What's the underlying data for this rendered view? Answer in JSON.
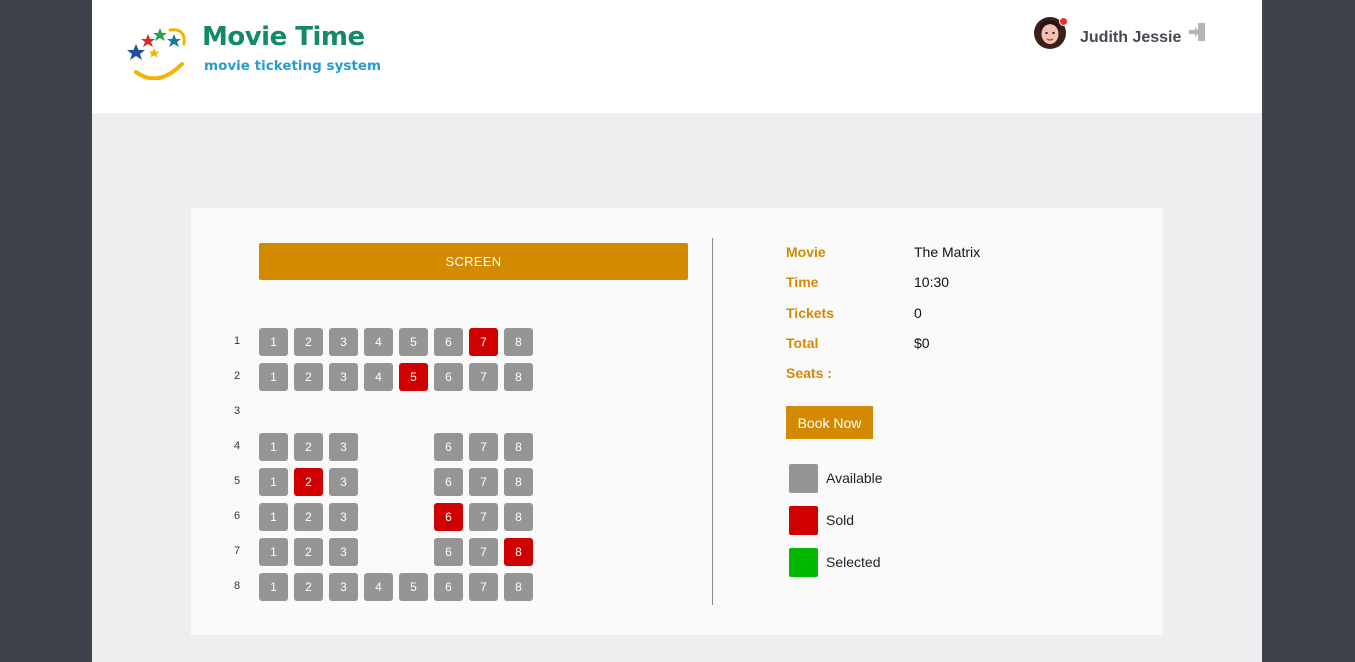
{
  "header": {
    "logo_title": "Movie Time",
    "logo_subtitle": "movie ticketing system",
    "user_name": "Judith Jessie"
  },
  "theater": {
    "screen_label": "SCREEN",
    "rows": [
      {
        "label": "1",
        "seats": [
          {
            "n": "1",
            "status": "available"
          },
          {
            "n": "2",
            "status": "available"
          },
          {
            "n": "3",
            "status": "available"
          },
          {
            "n": "4",
            "status": "available"
          },
          {
            "n": "5",
            "status": "available"
          },
          {
            "n": "6",
            "status": "available"
          },
          {
            "n": "7",
            "status": "sold"
          },
          {
            "n": "8",
            "status": "available"
          }
        ]
      },
      {
        "label": "2",
        "seats": [
          {
            "n": "1",
            "status": "available"
          },
          {
            "n": "2",
            "status": "available"
          },
          {
            "n": "3",
            "status": "available"
          },
          {
            "n": "4",
            "status": "available"
          },
          {
            "n": "5",
            "status": "sold"
          },
          {
            "n": "6",
            "status": "available"
          },
          {
            "n": "7",
            "status": "available"
          },
          {
            "n": "8",
            "status": "available"
          }
        ]
      },
      {
        "label": "3",
        "seats": []
      },
      {
        "label": "4",
        "seats": [
          {
            "n": "1",
            "status": "available"
          },
          {
            "n": "2",
            "status": "available"
          },
          {
            "n": "3",
            "status": "available"
          },
          null,
          null,
          {
            "n": "6",
            "status": "available"
          },
          {
            "n": "7",
            "status": "available"
          },
          {
            "n": "8",
            "status": "available"
          }
        ]
      },
      {
        "label": "5",
        "seats": [
          {
            "n": "1",
            "status": "available"
          },
          {
            "n": "2",
            "status": "sold"
          },
          {
            "n": "3",
            "status": "available"
          },
          null,
          null,
          {
            "n": "6",
            "status": "available"
          },
          {
            "n": "7",
            "status": "available"
          },
          {
            "n": "8",
            "status": "available"
          }
        ]
      },
      {
        "label": "6",
        "seats": [
          {
            "n": "1",
            "status": "available"
          },
          {
            "n": "2",
            "status": "available"
          },
          {
            "n": "3",
            "status": "available"
          },
          null,
          null,
          {
            "n": "6",
            "status": "sold"
          },
          {
            "n": "7",
            "status": "available"
          },
          {
            "n": "8",
            "status": "available"
          }
        ]
      },
      {
        "label": "7",
        "seats": [
          {
            "n": "1",
            "status": "available"
          },
          {
            "n": "2",
            "status": "available"
          },
          {
            "n": "3",
            "status": "available"
          },
          null,
          null,
          {
            "n": "6",
            "status": "available"
          },
          {
            "n": "7",
            "status": "available"
          },
          {
            "n": "8",
            "status": "sold"
          }
        ]
      },
      {
        "label": "8",
        "seats": [
          {
            "n": "1",
            "status": "available"
          },
          {
            "n": "2",
            "status": "available"
          },
          {
            "n": "3",
            "status": "available"
          },
          {
            "n": "4",
            "status": "available"
          },
          {
            "n": "5",
            "status": "available"
          },
          {
            "n": "6",
            "status": "available"
          },
          {
            "n": "7",
            "status": "available"
          },
          {
            "n": "8",
            "status": "available"
          }
        ]
      }
    ]
  },
  "booking": {
    "movie_label": "Movie",
    "movie_value": "The Matrix",
    "time_label": "Time",
    "time_value": "10:30",
    "tickets_label": "Tickets",
    "tickets_value": "0",
    "total_label": "Total",
    "total_value": "$0",
    "seats_label": "Seats :",
    "seats_value": "",
    "book_button": "Book Now"
  },
  "legend": [
    {
      "label": "Available",
      "status": "available"
    },
    {
      "label": "Sold",
      "status": "sold"
    },
    {
      "label": "Selected",
      "status": "selected"
    }
  ],
  "colors": {
    "available": "#959595",
    "sold": "#d00000",
    "selected": "#00b800",
    "accent": "#d48a00"
  },
  "icons": {
    "logout": "logout-icon",
    "avatar": "avatar"
  }
}
